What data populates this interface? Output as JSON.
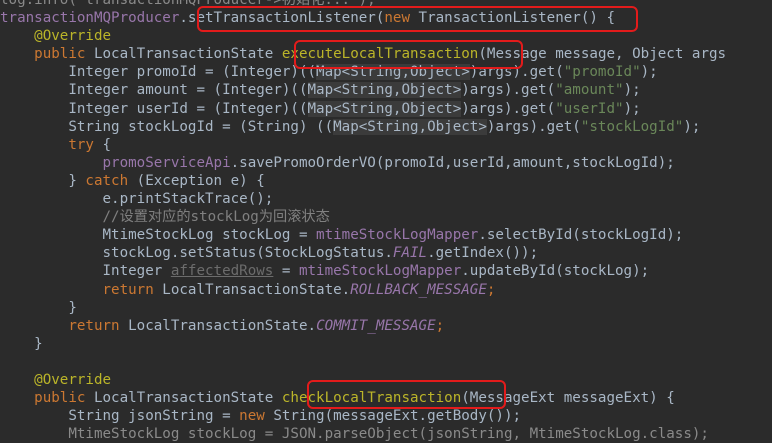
{
  "code_lines": [
    {
      "segs": [
        {
          "t": "log.info(\"transactionMQProducer->初始化...\");",
          "c": "muted"
        }
      ]
    },
    {
      "segs": [
        {
          "t": "transactionMQProducer",
          "c": "fld"
        },
        {
          "t": ".setTransactionListener("
        },
        {
          "t": "new ",
          "c": "kw"
        },
        {
          "t": "TransactionListener() {"
        }
      ]
    },
    {
      "segs": [
        {
          "t": "    "
        },
        {
          "t": "@Override",
          "c": "ann"
        }
      ]
    },
    {
      "segs": [
        {
          "t": "    "
        },
        {
          "t": "public ",
          "c": "kw"
        },
        {
          "t": "LocalTransactionState "
        },
        {
          "t": "executeLocalTransaction",
          "c": "ann"
        },
        {
          "t": "(Message message, Object args"
        }
      ]
    },
    {
      "segs": [
        {
          "t": "        Integer promoId = (Integer)(("
        },
        {
          "t": "Map<String,Object>",
          "c": "hl-cast"
        },
        {
          "t": ")args).get("
        },
        {
          "t": "\"promoId\"",
          "c": "str"
        },
        {
          "t": ");"
        }
      ]
    },
    {
      "segs": [
        {
          "t": "        Integer amount = (Integer)(("
        },
        {
          "t": "Map<String,Object>",
          "c": "hl-cast"
        },
        {
          "t": ")args).get("
        },
        {
          "t": "\"amount\"",
          "c": "str"
        },
        {
          "t": ");"
        }
      ]
    },
    {
      "segs": [
        {
          "t": "        Integer userId = (Integer)(("
        },
        {
          "t": "Map<String,Object>",
          "c": "hl-cast"
        },
        {
          "t": ")args).get("
        },
        {
          "t": "\"userId\"",
          "c": "str"
        },
        {
          "t": ");"
        }
      ]
    },
    {
      "segs": [
        {
          "t": "        String stockLogId = (String) (("
        },
        {
          "t": "Map<String,Object>",
          "c": "hl-cast"
        },
        {
          "t": ")args).get("
        },
        {
          "t": "\"stockLogId\"",
          "c": "str"
        },
        {
          "t": ");"
        }
      ]
    },
    {
      "segs": [
        {
          "t": "        "
        },
        {
          "t": "try ",
          "c": "kw"
        },
        {
          "t": "{"
        }
      ]
    },
    {
      "segs": [
        {
          "t": "            "
        },
        {
          "t": "promoServiceApi",
          "c": "fld"
        },
        {
          "t": ".savePromoOrderVO(promoId,userId,amount,stockLogId);"
        }
      ]
    },
    {
      "segs": [
        {
          "t": "        } "
        },
        {
          "t": "catch ",
          "c": "kw"
        },
        {
          "t": "(Exception e) {"
        }
      ]
    },
    {
      "segs": [
        {
          "t": "            e.printStackTrace();"
        }
      ]
    },
    {
      "segs": [
        {
          "t": "            "
        },
        {
          "t": "//设置对应的stockLog为回滚状态",
          "c": "cmt"
        }
      ]
    },
    {
      "segs": [
        {
          "t": "            MtimeStockLog stockLog = "
        },
        {
          "t": "mtimeStockLogMapper",
          "c": "fld"
        },
        {
          "t": ".selectById(stockLogId);"
        }
      ]
    },
    {
      "segs": [
        {
          "t": "            stockLog.setStatus(StockLogStatus."
        },
        {
          "t": "FAIL",
          "c": "fld ital"
        },
        {
          "t": ".getIndex());"
        }
      ]
    },
    {
      "segs": [
        {
          "t": "            Integer "
        },
        {
          "t": "affectedRows",
          "c": "dim"
        },
        {
          "t": " = "
        },
        {
          "t": "mtimeStockLogMapper",
          "c": "fld"
        },
        {
          "t": ".updateById(stockLog);"
        }
      ]
    },
    {
      "segs": [
        {
          "t": "            "
        },
        {
          "t": "return ",
          "c": "kw"
        },
        {
          "t": "LocalTransactionState."
        },
        {
          "t": "ROLLBACK_MESSAGE",
          "c": "fld ital"
        },
        {
          "t": ";",
          "c": "kw"
        }
      ]
    },
    {
      "segs": [
        {
          "t": "        }"
        }
      ]
    },
    {
      "segs": [
        {
          "t": "        "
        },
        {
          "t": "return ",
          "c": "kw"
        },
        {
          "t": "LocalTransactionState."
        },
        {
          "t": "COMMIT_MESSAGE",
          "c": "fld ital"
        },
        {
          "t": ";",
          "c": "kw"
        }
      ]
    },
    {
      "segs": [
        {
          "t": "    }"
        }
      ]
    },
    {
      "segs": [
        {
          "t": ""
        }
      ]
    },
    {
      "segs": [
        {
          "t": "    "
        },
        {
          "t": "@Override",
          "c": "ann"
        }
      ]
    },
    {
      "segs": [
        {
          "t": "    "
        },
        {
          "t": "public ",
          "c": "kw"
        },
        {
          "t": "LocalTransactionState "
        },
        {
          "t": "checkLocalTransaction",
          "c": "ann"
        },
        {
          "t": "(MessageExt messageExt) {"
        }
      ]
    },
    {
      "segs": [
        {
          "t": "        String jsonString = "
        },
        {
          "t": "new ",
          "c": "kw"
        },
        {
          "t": "String(messageExt.getBody());"
        }
      ]
    },
    {
      "segs": [
        {
          "t": "        MtimeStockLog stockLog = JSON.parseObject(jsonString, MtimeStockLog.class);",
          "c": "muted"
        }
      ]
    }
  ],
  "colors": {
    "background": "#2b2b2b",
    "highlight_box": "#e31b1b",
    "keyword": "#cc7832",
    "annotation": "#bbb529",
    "string": "#6a8759",
    "field": "#9876aa"
  }
}
